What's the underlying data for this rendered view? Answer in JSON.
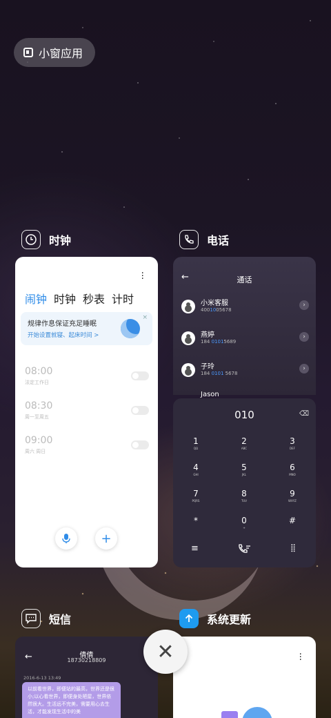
{
  "pill": {
    "label": "小窗应用"
  },
  "apps": {
    "clock": {
      "name": "时钟"
    },
    "phone": {
      "name": "电话"
    },
    "sms": {
      "name": "短信"
    },
    "update": {
      "name": "系统更新"
    }
  },
  "clock": {
    "tabs": [
      "闹钟",
      "时钟",
      "秒表",
      "计时"
    ],
    "banner": {
      "title": "规律作息保证充足睡眠",
      "subtitle": "开始设置就寝、起床时间 >",
      "close": "×"
    },
    "alarms": [
      {
        "time": "08:00",
        "repeat": "法定工作日"
      },
      {
        "time": "08:30",
        "repeat": "周一至周五"
      },
      {
        "time": "09:00",
        "repeat": "周六 周日"
      }
    ]
  },
  "phone": {
    "title": "通话",
    "contacts": [
      {
        "name": "小米客服",
        "num_pre": "400",
        "num_hl": "10",
        "num_post": "05678"
      },
      {
        "name": "燕婷",
        "num_pre": "184 ",
        "num_hl": "0101",
        "num_post": "5689"
      },
      {
        "name": "子玲",
        "num_pre": "184 ",
        "num_hl": "0101",
        "num_post": " 5678"
      },
      {
        "name": "Jason",
        "num_pre": "",
        "num_hl": "",
        "num_post": ""
      }
    ],
    "dial_number": "010",
    "keys": [
      {
        "d": "1",
        "l": "QΩ"
      },
      {
        "d": "2",
        "l": "ABC"
      },
      {
        "d": "3",
        "l": "DEF"
      },
      {
        "d": "4",
        "l": "GHI"
      },
      {
        "d": "5",
        "l": "JKL"
      },
      {
        "d": "6",
        "l": "MNO"
      },
      {
        "d": "7",
        "l": "PQRS"
      },
      {
        "d": "8",
        "l": "TUV"
      },
      {
        "d": "9",
        "l": "WXYZ"
      },
      {
        "d": "*",
        "l": ""
      },
      {
        "d": "0",
        "l": "+"
      },
      {
        "d": "#",
        "l": ""
      }
    ]
  },
  "sms": {
    "name": "倩倩",
    "phone": "18730218809",
    "date": "2016-6-13 13:49",
    "message": "以前看世界，即便站的最高，世界还是很小;以心看世界，即便身处陋屋，世界依然很大。生活远不完美，需要用心去生活，才能发现生活中的美"
  }
}
